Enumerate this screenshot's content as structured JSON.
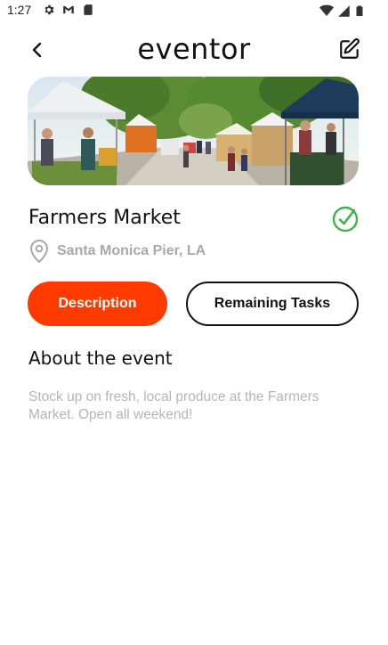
{
  "status_bar": {
    "time": "1:27",
    "left_icons": [
      "gear-icon",
      "gmail-icon",
      "sd-card-icon"
    ],
    "right_icons": [
      "wifi-icon",
      "signal-icon",
      "battery-icon"
    ]
  },
  "header": {
    "title": "eventor",
    "back_icon": "chevron-left-icon",
    "edit_icon": "edit-icon"
  },
  "event": {
    "name": "Farmers Market",
    "location": "Santa Monica Pier, LA",
    "completed_icon": "check-circle-icon",
    "check_color": "#3bb54a"
  },
  "tabs": {
    "description": "Description",
    "remaining": "Remaining Tasks",
    "active": "description",
    "active_color": "#ff3a00"
  },
  "about": {
    "heading": "About the event",
    "text": "Stock up on fresh, local produce at the Farmers Market. Open all weekend!"
  }
}
